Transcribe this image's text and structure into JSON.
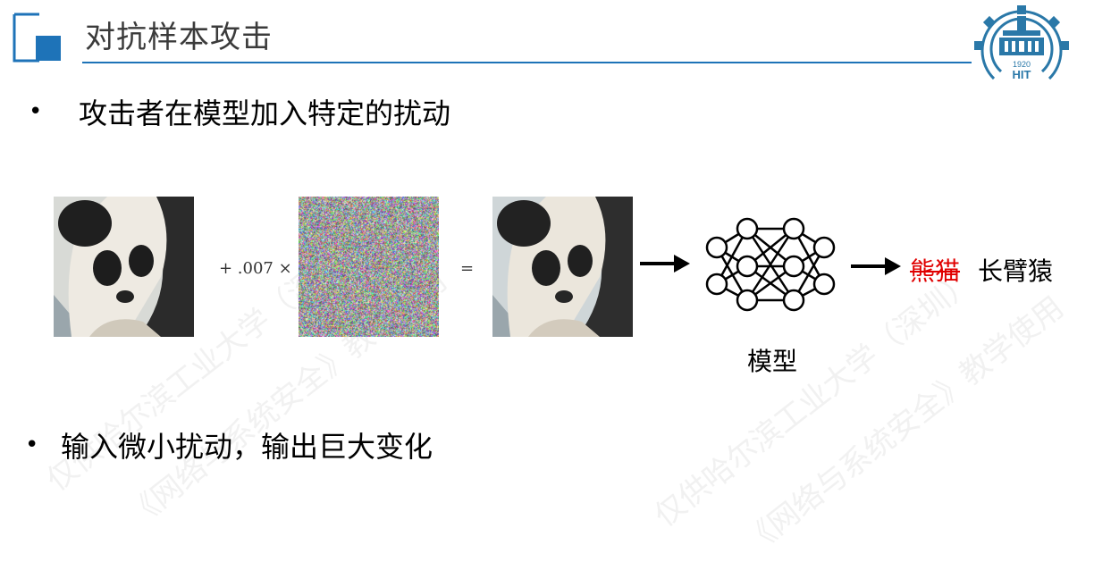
{
  "slide": {
    "title": "对抗样本攻击",
    "bullet1": "攻击者在模型加入特定的扰动",
    "bullet2": "输入微小扰动，输出巨大变化",
    "bullet_symbol": "•"
  },
  "figure": {
    "op_add": "+ .007 ×",
    "op_equal": "=",
    "model_caption": "模型",
    "label_original": "熊猫",
    "label_adversarial": "长臂猿"
  },
  "logo": {
    "year": "1920",
    "letters": "HIT"
  },
  "watermark": {
    "line1": "仅供哈尔滨工业大学（深圳）",
    "line2": "《网络与系统安全》教学使用"
  },
  "colors": {
    "accent": "#1e73b8",
    "strike": "#e00000"
  },
  "icons": [
    "corner-square-icon",
    "hit-logo-icon",
    "panda-image",
    "noise-image",
    "neural-network-icon",
    "arrow-right-icon"
  ]
}
